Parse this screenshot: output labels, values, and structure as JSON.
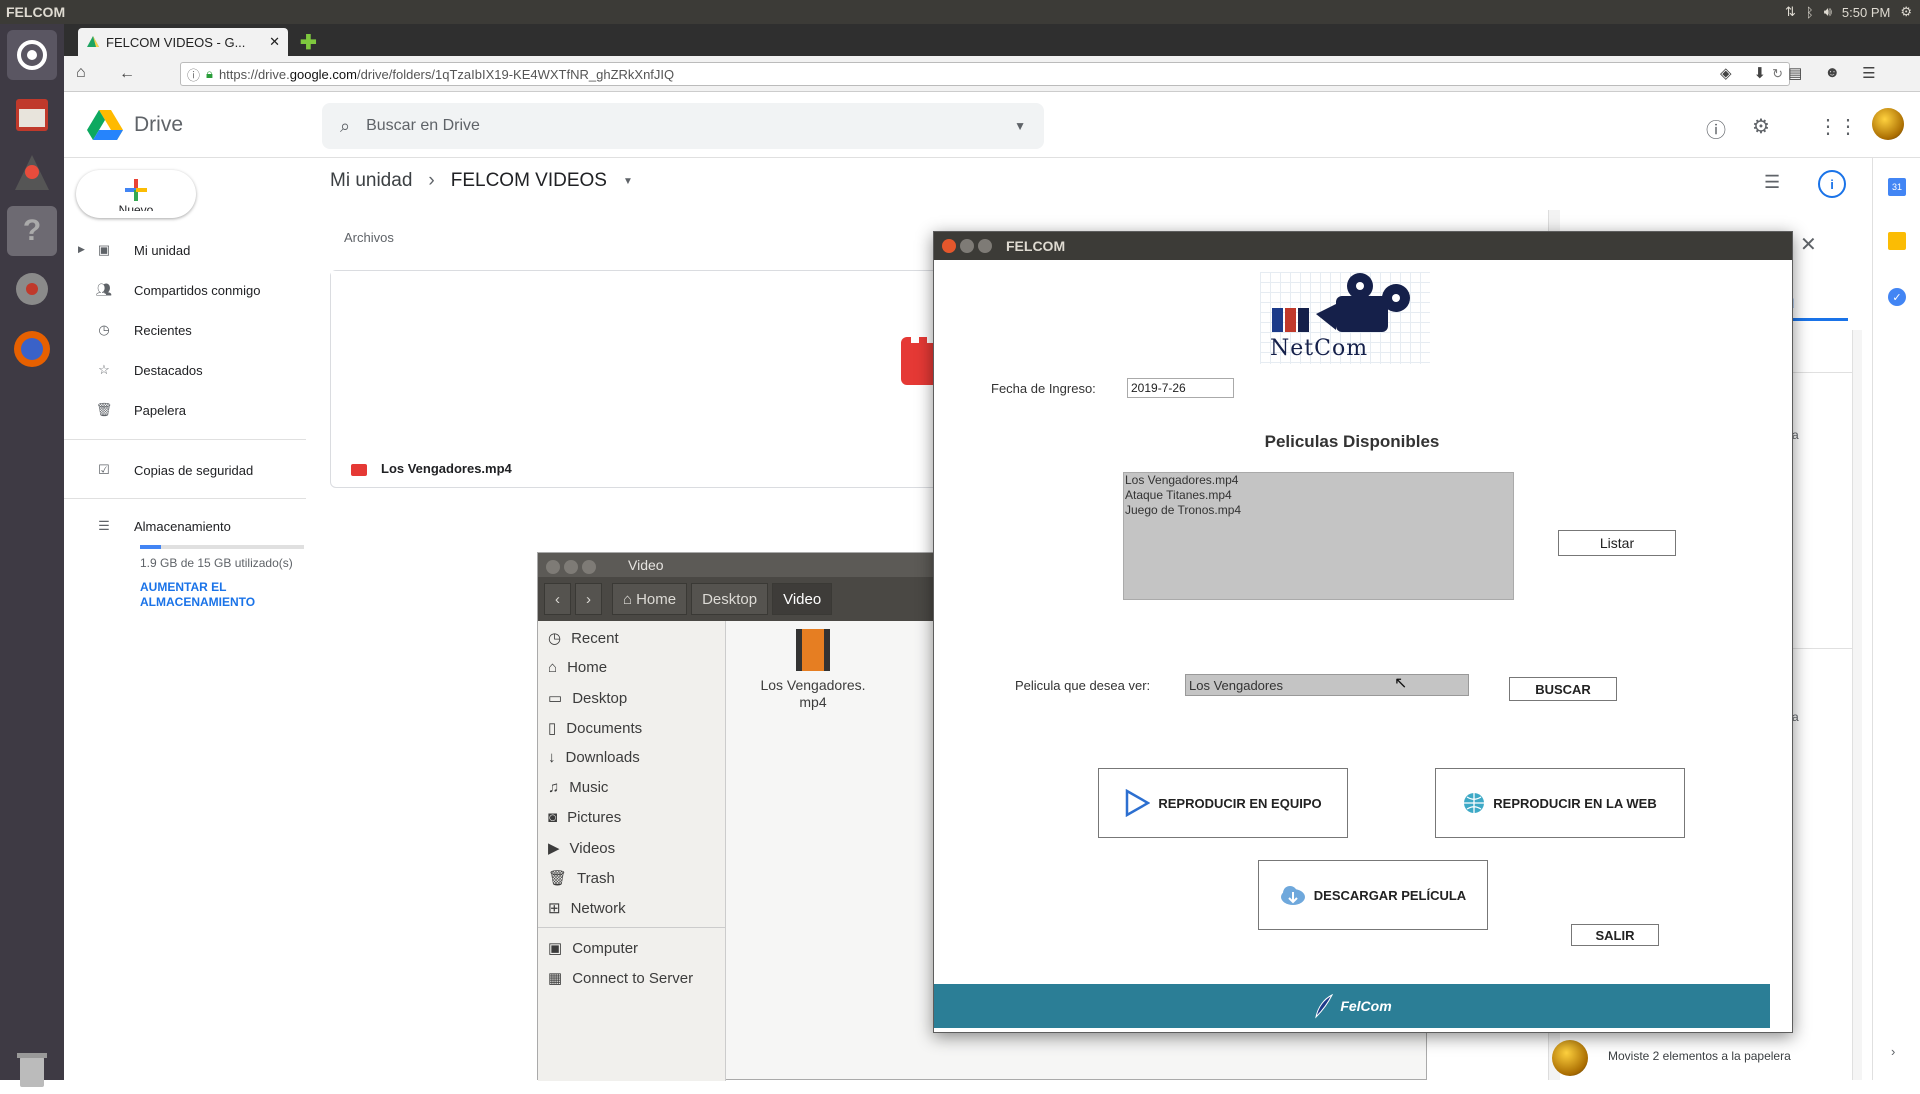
{
  "top_panel": {
    "app_name": "FELCOM",
    "time": "5:50 PM"
  },
  "browser": {
    "tab_title": "FELCOM VIDEOS - G...",
    "url_prefix": "https://drive.",
    "url_domain": "google.com",
    "url_rest": "/drive/folders/1qTzaIbIX19-KE4WXTfNR_ghZRkXnfJIQ"
  },
  "drive": {
    "app_name": "Drive",
    "search_placeholder": "Buscar en Drive",
    "new_label": "Nuevo",
    "nav": {
      "my_drive": "Mi unidad",
      "shared": "Compartidos conmigo",
      "recent": "Recientes",
      "starred": "Destacados",
      "trash": "Papelera",
      "backups": "Copias de seguridad",
      "storage": "Almacenamiento"
    },
    "storage_used": "1.9 GB de 15 GB utilizado(s)",
    "storage_fraction": 0.127,
    "upgrade_line1": "AUMENTAR EL",
    "upgrade_line2": "ALMACENAMIENTO",
    "breadcrumb_root": "Mi unidad",
    "breadcrumb_current": "FELCOM VIDEOS",
    "files_header": "Archivos",
    "file_name": "Los Vengadores.mp4",
    "details_tab_partial": "ad",
    "activity_partial_1": "a",
    "activity_partial_2": "a",
    "activity_text": "Moviste 2 elementos a la papelera"
  },
  "nautilus": {
    "title": "Video",
    "path": {
      "home": "Home",
      "desktop": "Desktop",
      "video": "Video"
    },
    "sidebar": {
      "recent": "Recent",
      "home": "Home",
      "desktop": "Desktop",
      "documents": "Documents",
      "downloads": "Downloads",
      "music": "Music",
      "pictures": "Pictures",
      "videos": "Videos",
      "trash": "Trash",
      "network": "Network",
      "computer": "Computer",
      "connect": "Connect to Server"
    },
    "file_line1": "Los Vengadores.",
    "file_line2": "mp4"
  },
  "felcom": {
    "title": "FELCOM",
    "logo_text": "NetCom",
    "date_label": "Fecha de Ingreso:",
    "date_value": "2019-7-26",
    "section_title": "Peliculas Disponibles",
    "movies": [
      "Los Vengadores.mp4",
      "Ataque Titanes.mp4",
      "Juego de Tronos.mp4"
    ],
    "list_button": "Listar",
    "search_label": "Pelicula que desea ver:",
    "search_value": "Los Vengadores",
    "search_button": "BUSCAR",
    "play_local": "REPRODUCIR EN EQUIPO",
    "play_web": "REPRODUCIR EN LA WEB",
    "download": "DESCARGAR PELÍCULA",
    "exit": "SALIR",
    "footer": "FelCom"
  }
}
